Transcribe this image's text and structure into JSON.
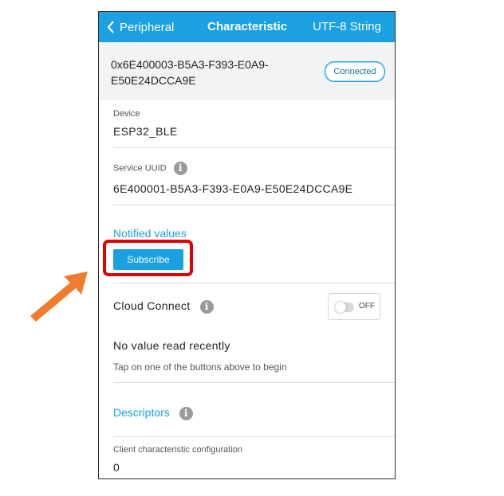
{
  "nav": {
    "back_label": "Peripheral",
    "title": "Characteristic",
    "right_label": "UTF-8 String"
  },
  "characteristic": {
    "uuid": "0x6E400003-B5A3-F393-E0A9-E50E24DCCA9E",
    "status": "Connected"
  },
  "device": {
    "label": "Device",
    "value": "ESP32_BLE"
  },
  "service": {
    "label": "Service UUID",
    "value": "6E400001-B5A3-F393-E0A9-E50E24DCCA9E"
  },
  "notified": {
    "title": "Notified values",
    "button": "Subscribe"
  },
  "cloud": {
    "label": "Cloud Connect",
    "toggle": "OFF"
  },
  "read": {
    "title": "No value read recently",
    "hint": "Tap on one of the buttons above to begin"
  },
  "descriptors": {
    "title": "Descriptors",
    "item_label": "Client characteristic configuration",
    "item_value": "0"
  },
  "colors": {
    "accent": "#1ba0e2",
    "highlight": "#e00000",
    "arrow": "#ef7d2e"
  },
  "icons": {
    "back": "chevron-left-icon",
    "info": "info-icon"
  }
}
